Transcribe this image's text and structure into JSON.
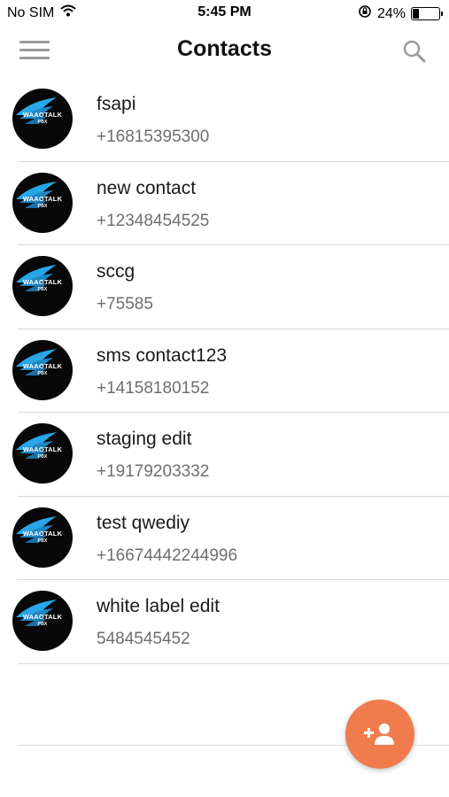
{
  "status_bar": {
    "carrier": "No SIM",
    "time": "5:45 PM",
    "battery_percent": "24%",
    "battery_level": 0.24
  },
  "header": {
    "title": "Contacts"
  },
  "avatar": {
    "brand": "WAAOTALK",
    "sub": "PBX"
  },
  "contacts": [
    {
      "name": "fsapi",
      "phone": "+16815395300"
    },
    {
      "name": "new contact",
      "phone": "+12348454525"
    },
    {
      "name": "sccg",
      "phone": "+75585"
    },
    {
      "name": "sms contact123",
      "phone": "+14158180152"
    },
    {
      "name": "staging edit",
      "phone": "+19179203332"
    },
    {
      "name": "test qwediy",
      "phone": "+16674442244996"
    },
    {
      "name": "white label edit",
      "phone": "5484545452"
    }
  ],
  "colors": {
    "fab": "#f07c4e",
    "accent_blue": "#29a6e8"
  }
}
